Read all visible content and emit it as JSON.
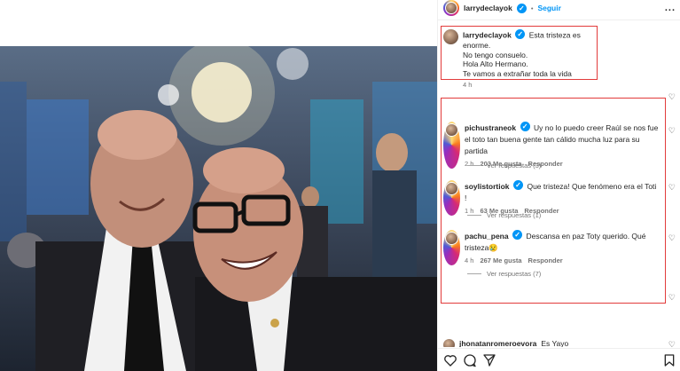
{
  "header": {
    "username": "larrydeclayok",
    "separator": "•",
    "follow_label": "Seguir",
    "more_label": "..."
  },
  "caption": {
    "username": "larrydeclayok",
    "lines": [
      "Esta tristeza es enorme.",
      "No tengo consuelo.",
      "Hola Alto Hermano.",
      "Te vamos a extrañar toda la vida"
    ],
    "time": "4 h"
  },
  "comments": [
    {
      "username": "pichustraneok",
      "text": "Uy no lo puedo creer Raúl se nos fue el toto tan buena gente tan cálido mucha luz para su partida",
      "time": "2 h",
      "likes": "203 Me gusta",
      "reply_label": "Responder",
      "view_replies": "Ver respuestas (3)"
    },
    {
      "username": "soylistortiok",
      "text": "Que tristeza! Que fenómeno era el Toti !",
      "time": "1 h",
      "likes": "63 Me gusta",
      "reply_label": "Responder",
      "view_replies": "Ver respuestas (1)"
    },
    {
      "username": "pachu_pena",
      "text": "Descansa en paz Toty querido. Qué tristeza😢",
      "time": "4 h",
      "likes": "267 Me gusta",
      "reply_label": "Responder",
      "view_replies": "Ver respuestas (7)"
    }
  ],
  "partial_comment": {
    "username": "jhonatanromeroevora",
    "text": "Es Yayo"
  },
  "colors": {
    "highlight_border": "#e23b3b",
    "verified": "#0095f6",
    "follow": "#0095f6"
  },
  "icons": [
    "heart-icon",
    "comment-icon",
    "share-icon",
    "bookmark-icon",
    "verified-icon",
    "more-icon"
  ]
}
